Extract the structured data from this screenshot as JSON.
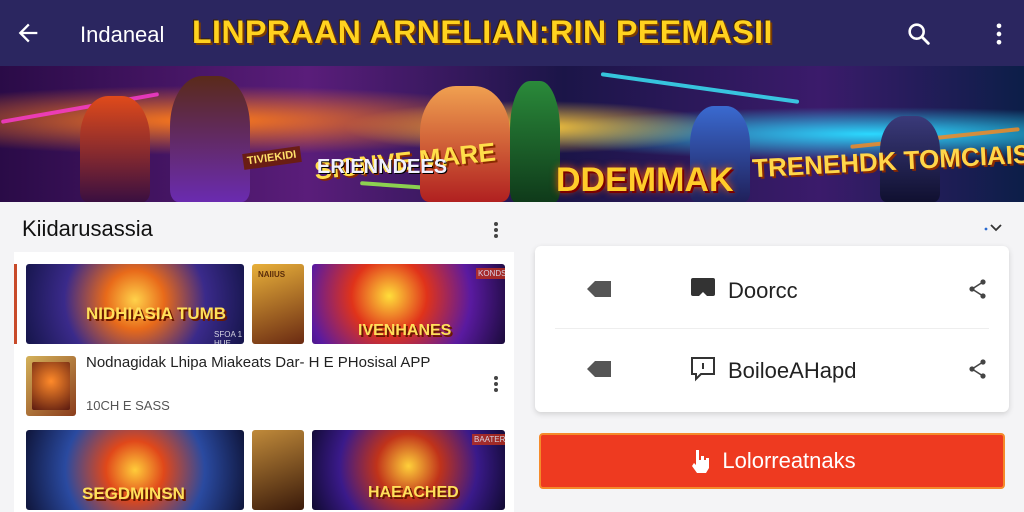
{
  "appbar": {
    "title": "Indaneal",
    "headline": "LINPRAAN ARNELIAN:RIN PEEMASII",
    "icons": [
      "arrow-back-icon",
      "search-icon",
      "more-vert-icon"
    ]
  },
  "banner": {
    "badge_small": "TIVIEKIDI",
    "badge_1": "SIONVE MARE",
    "badge_2": "DDEMMAK",
    "badge_3": "TRENEHDK TOMCIAIS",
    "subtitle": "ERIENNDEES"
  },
  "section": {
    "title": "Kiidarusassia",
    "tiles_row1": [
      {
        "label": "NIDHIASIA TUMB",
        "tiny": "SFOA 1 HUE"
      },
      {
        "label": "",
        "tiny": "NAIIUS"
      },
      {
        "label": "IVENHANES",
        "tiny": "KONDS"
      }
    ],
    "app_row": {
      "title": "Nodnagidak Lhipa Miakeats Dar- H E PHosisal APP",
      "subtitle": "10CH E SASS"
    },
    "tiles_row2": [
      {
        "label": "SEGDMINSN",
        "tiny": ""
      },
      {
        "label": "",
        "tiny": ""
      },
      {
        "label": "HAEACHED",
        "tiny": "BAATER"
      }
    ]
  },
  "card": {
    "rows": [
      {
        "label": "Doorcc"
      },
      {
        "label": "BoiloeAHapd"
      }
    ]
  },
  "cta": {
    "label": "Lolorreatnaks"
  },
  "colors": {
    "appbar": "#2b2660",
    "headline": "#ffd21f",
    "cta": "#ee3a20"
  }
}
